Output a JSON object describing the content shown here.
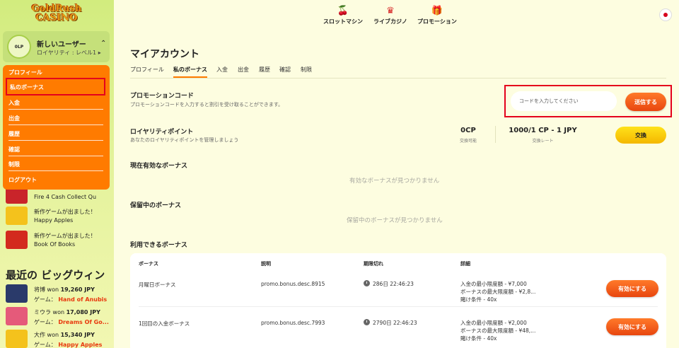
{
  "brand": {
    "logo_line1": "GoldRush",
    "logo_line2": "CASINO"
  },
  "user": {
    "avatar": "0LP",
    "name": "新しいユーザー",
    "level": "ロイヤリティ : レベル1 ▸"
  },
  "menu": {
    "items": [
      "プロフィール",
      "私のボーナス",
      "入金",
      "出金",
      "履歴",
      "確認",
      "制限",
      "ログアウト"
    ]
  },
  "games": [
    {
      "l1": "Fire 4 Cash Collect Qu",
      "l2": ""
    },
    {
      "l1": "新作ゲームが出ました！",
      "l2": "Happy Apples"
    },
    {
      "l1": "新作ゲームが出ました！",
      "l2": "Book Of Books"
    }
  ],
  "big_wins": {
    "title": "最近の ビッグウィン",
    "items": [
      {
        "user": "将博 won",
        "amount": "19,260 JPY",
        "game_label": "ゲーム：",
        "game": "Hand of Anubis"
      },
      {
        "user": "ミウラ won",
        "amount": "17,080 JPY",
        "game_label": "ゲーム：",
        "game": "Dreams Of Go..."
      },
      {
        "user": "大作 won",
        "amount": "15,340 JPY",
        "game_label": "ゲーム：",
        "game": "Happy Apples"
      }
    ]
  },
  "topnav": [
    {
      "icon": "cherry-icon",
      "label": "スロットマシン"
    },
    {
      "icon": "dealer-icon",
      "label": "ライブカジノ"
    },
    {
      "icon": "gift-icon",
      "label": "プロモーション"
    }
  ],
  "account": {
    "title": "マイアカウント",
    "tabs": [
      "プロフィール",
      "私のボーナス",
      "入金",
      "出金",
      "履歴",
      "確認",
      "制限"
    ],
    "active_tab": "私のボーナス"
  },
  "promo": {
    "title": "プロモーションコード",
    "subtitle": "プロモーションコードを入力すると割引を受け取ることができます。",
    "placeholder": "コードを入力してください",
    "button": "送信する"
  },
  "loyalty": {
    "title": "ロイヤリティポイント",
    "subtitle": "あなたのロイヤリティポイントを管理しましょう",
    "cp_value": "0CP",
    "cp_label": "交換可能",
    "rate_value": "1000/1 CP - 1 JPY",
    "rate_label": "交換レート",
    "button": "交換"
  },
  "active_bonus": {
    "title": "現在有効なボーナス",
    "empty": "有効なボーナスが見つかりません"
  },
  "pending_bonus": {
    "title": "保留中のボーナス",
    "empty": "保留中のボーナスが見つかりません"
  },
  "available": {
    "title": "利用できるボーナス",
    "headers": [
      "ボーナス",
      "説明",
      "期限切れ",
      "詳細"
    ],
    "rows": [
      {
        "name": "月曜日ボーナス",
        "desc": "promo.bonus.desc.8915",
        "expires": "286日 22:46:23",
        "d1": "入金の最小限度額 - ¥7,000",
        "d2": "ボーナスの最大限度額 - ¥2,8...",
        "d3": "賭け条件 - 40x",
        "button": "有効にする"
      },
      {
        "name": "1回目の入金ボーナス",
        "desc": "promo.bonus.desc.7993",
        "expires": "2790日 22:46:23",
        "d1": "入金の最小限度額 - ¥2,000",
        "d2": "ボーナスの最大限度額 - ¥48,...",
        "d3": "賭け条件 - 40x",
        "button": "有効にする"
      }
    ]
  },
  "colors": {
    "accent": "#ff7b00",
    "highlight_border": "#e4001c",
    "exchange": "#f4c400"
  }
}
